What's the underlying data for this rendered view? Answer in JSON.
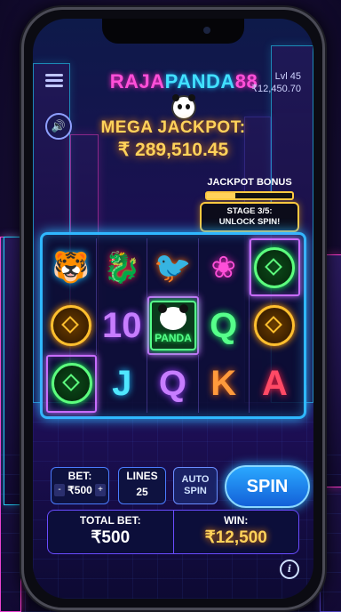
{
  "header": {
    "logo_raja": "RAJA",
    "logo_panda": "PANDA",
    "logo_num": "88",
    "level": "Lvl 45",
    "balance": "₹12,450.70"
  },
  "jackpot": {
    "title": "MEGA JACKPOT:",
    "value": "₹ 289,510.45"
  },
  "bonus": {
    "title": "JACKPOT BONUS",
    "progress": 0.33,
    "stage_line1": "STAGE 3/5:",
    "stage_line2": "UNLOCK SPIN!"
  },
  "reels": {
    "row1": [
      "tiger",
      "dragon",
      "phoenix",
      "lotus",
      "coin-green"
    ],
    "row2": [
      "coin-gold",
      "10",
      "panda",
      "Q",
      "coin-gold"
    ],
    "row3": [
      "coin-green",
      "J",
      "Q",
      "K",
      "A"
    ],
    "panda_label": "PANDA"
  },
  "controls": {
    "bet_label": "BET:",
    "bet_value": "₹500",
    "minus": "-",
    "plus": "+",
    "lines_label": "LINES",
    "lines_value": "25",
    "auto_line1": "AUTO",
    "auto_line2": "SPIN",
    "spin_label": "SPIN"
  },
  "totals": {
    "total_bet_label": "TOTAL BET:",
    "total_bet_value": "₹500",
    "win_label": "WIN:",
    "win_value": "₹12,500"
  },
  "colors": {
    "accent_cyan": "#2fb8ff",
    "accent_magenta": "#ff4fd8",
    "gold": "#ffd25a"
  },
  "icons": {
    "menu": "menu-icon",
    "sound": "speaker-icon",
    "info": "info-icon"
  }
}
